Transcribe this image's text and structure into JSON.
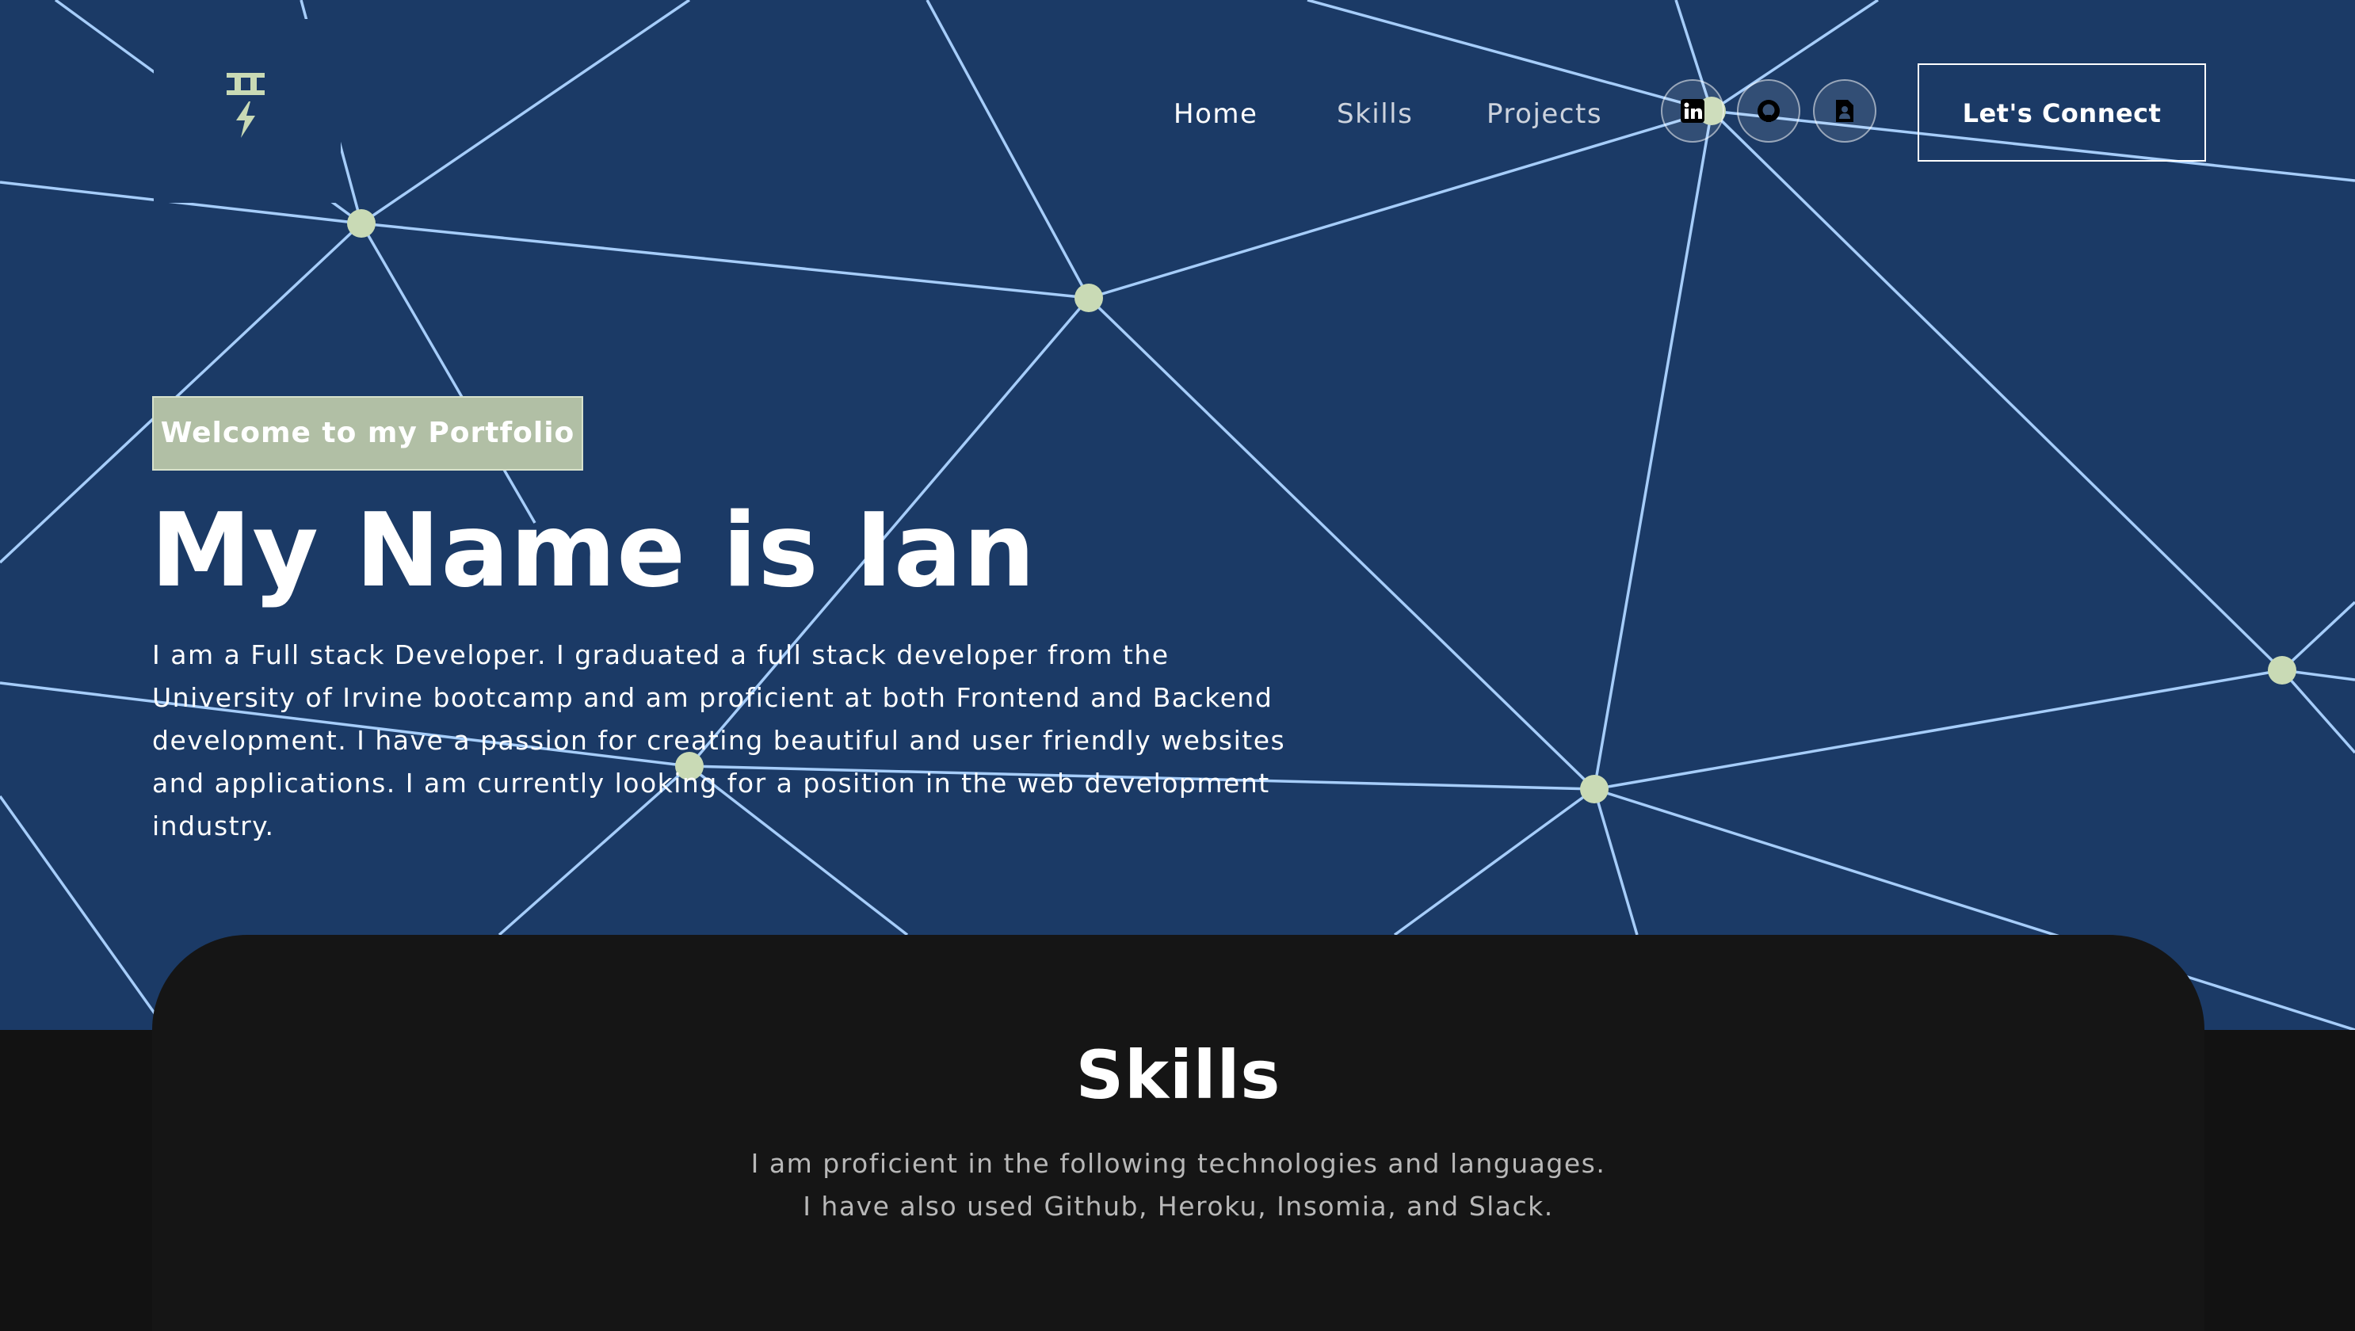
{
  "nav": {
    "logo_icon": "initials-bolt-logo-icon",
    "links": [
      "Home",
      "Skills",
      "Projects"
    ],
    "active_link": "Home",
    "social": [
      {
        "name": "linkedin",
        "icon": "linkedin-icon"
      },
      {
        "name": "github",
        "icon": "github-icon"
      },
      {
        "name": "resume",
        "icon": "document-icon"
      }
    ],
    "connect_label": "Let's Connect"
  },
  "hero": {
    "tagline": "Welcome to my Portfolio",
    "title": "My Name is Ian",
    "description": "I am a Full stack Developer. I graduated a full stack developer from the University of Irvine bootcamp and am proficient at both Frontend and Backend development. I have a passion for creating beautiful and user friendly websites and applications. I am currently looking for a position in the web development industry."
  },
  "skills": {
    "title": "Skills",
    "line1": "I am proficient in the following technologies and languages.",
    "line2": "I have also used Github, Heroku, Insomia, and Slack."
  },
  "colors": {
    "hero_background": "#1b3a66",
    "network_lines": "#a6cdfa",
    "network_nodes": "#c9dab5",
    "tagline_background": "#b1bfa5",
    "page_background": "#121212",
    "card_background": "#151515"
  }
}
